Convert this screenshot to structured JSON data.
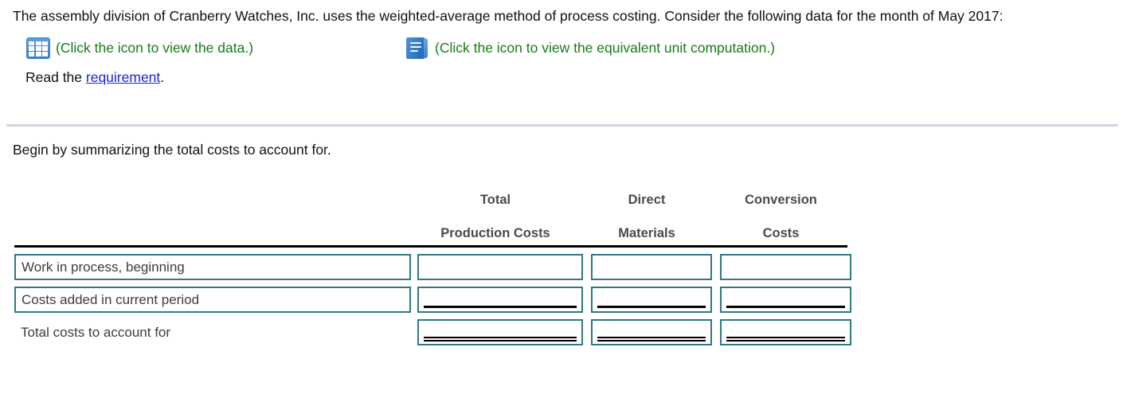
{
  "problem": {
    "statement": "The assembly division of Cranberry Watches, Inc. uses the weighted-average method of process costing. Consider the following data for  the month of May 2017:",
    "data_link": {
      "icon": "grid-table-icon",
      "label": "(Click the icon to view the data.)",
      "color": "#1a7a1a"
    },
    "computation_link": {
      "icon": "book-icon",
      "label": "(Click the icon to view the equivalent unit computation.)",
      "color": "#1a7a1a"
    },
    "read_prefix": "Read the ",
    "read_link": "requirement",
    "read_suffix": ".",
    "link_color": "#1a25d8"
  },
  "answer": {
    "instruction": "Begin by summarizing the total costs to account for.",
    "table": {
      "headers_line1": [
        "Total",
        "Direct",
        "Conversion"
      ],
      "headers_line2": [
        "Production Costs",
        "Materials",
        "Costs"
      ],
      "rows": [
        {
          "label": "Work in process, beginning",
          "label_editable": true,
          "cells": [
            "",
            "",
            ""
          ],
          "rule": "none"
        },
        {
          "label": "Costs added in current period",
          "label_editable": true,
          "cells": [
            "",
            "",
            ""
          ],
          "rule": "single"
        },
        {
          "label": "Total costs to account for",
          "label_editable": false,
          "cells": [
            "",
            "",
            ""
          ],
          "rule": "double"
        }
      ]
    }
  },
  "theme": {
    "input_border": "#2e7887",
    "rule_color": "#000000",
    "divider_color": "#d3d4e0",
    "text_color": "#111111",
    "header_text": "#4a4a4a"
  }
}
